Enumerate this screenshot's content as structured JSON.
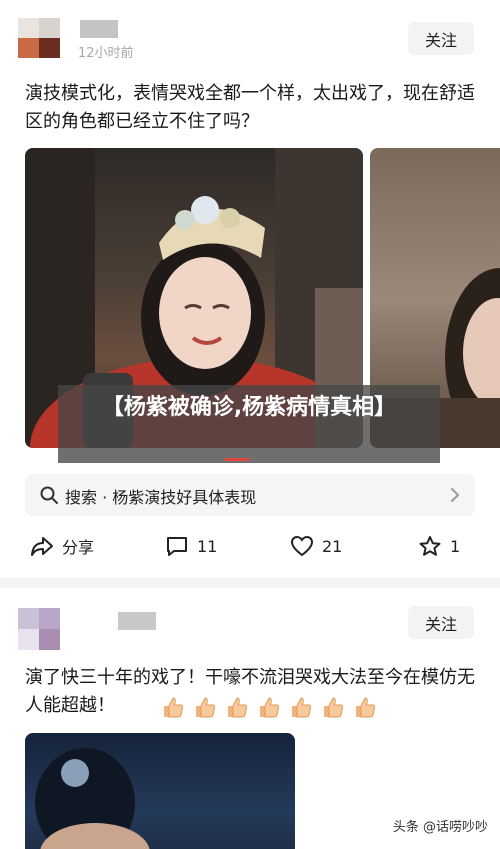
{
  "post1": {
    "time": "12小时前",
    "follow_label": "关注",
    "text": "演技模式化，表情哭戏全都一个样，太出戏了，现在舒适区的角色都已经立不住了吗？",
    "headline": "【杨紫被确诊,杨紫病情真相】",
    "search_label": "搜索 · 杨紫演技好具体表现",
    "actions": {
      "share_label": "分享",
      "comment_count": "11",
      "like_count": "21",
      "favorite_count": "1"
    }
  },
  "post2": {
    "follow_label": "关注",
    "text": "演了快三十年的戏了！干嚎不流泪哭戏大法至今在模仿无人能超越！"
  },
  "watermark": "头条 @话唠吵吵",
  "colors": {
    "accent_red": "#e0473c",
    "banner_bg": "#464646"
  },
  "icons": [
    "search-icon",
    "chevron-right-icon",
    "share-icon",
    "comment-icon",
    "heart-icon",
    "star-icon",
    "thumbs-up-icon"
  ]
}
